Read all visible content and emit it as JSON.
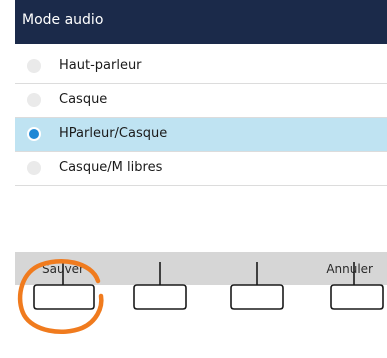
{
  "header": {
    "title": "Mode audio"
  },
  "options": [
    {
      "label": "Haut-parleur",
      "selected": false
    },
    {
      "label": "Casque",
      "selected": false
    },
    {
      "label": "HParleur/Casque",
      "selected": true
    },
    {
      "label": "Casque/M libres",
      "selected": false
    }
  ],
  "softkeys": {
    "left_label": "Sauver",
    "right_label": "Annuler"
  },
  "colors": {
    "titlebar": "#1b2a4a",
    "selected_row": "#bfe3f2",
    "radio_selected": "#1e88d6",
    "highlight_circle": "#f07b1e"
  },
  "icons": {
    "softkey_key": "softkey-button-icon",
    "highlight": "highlight-circle-icon"
  }
}
